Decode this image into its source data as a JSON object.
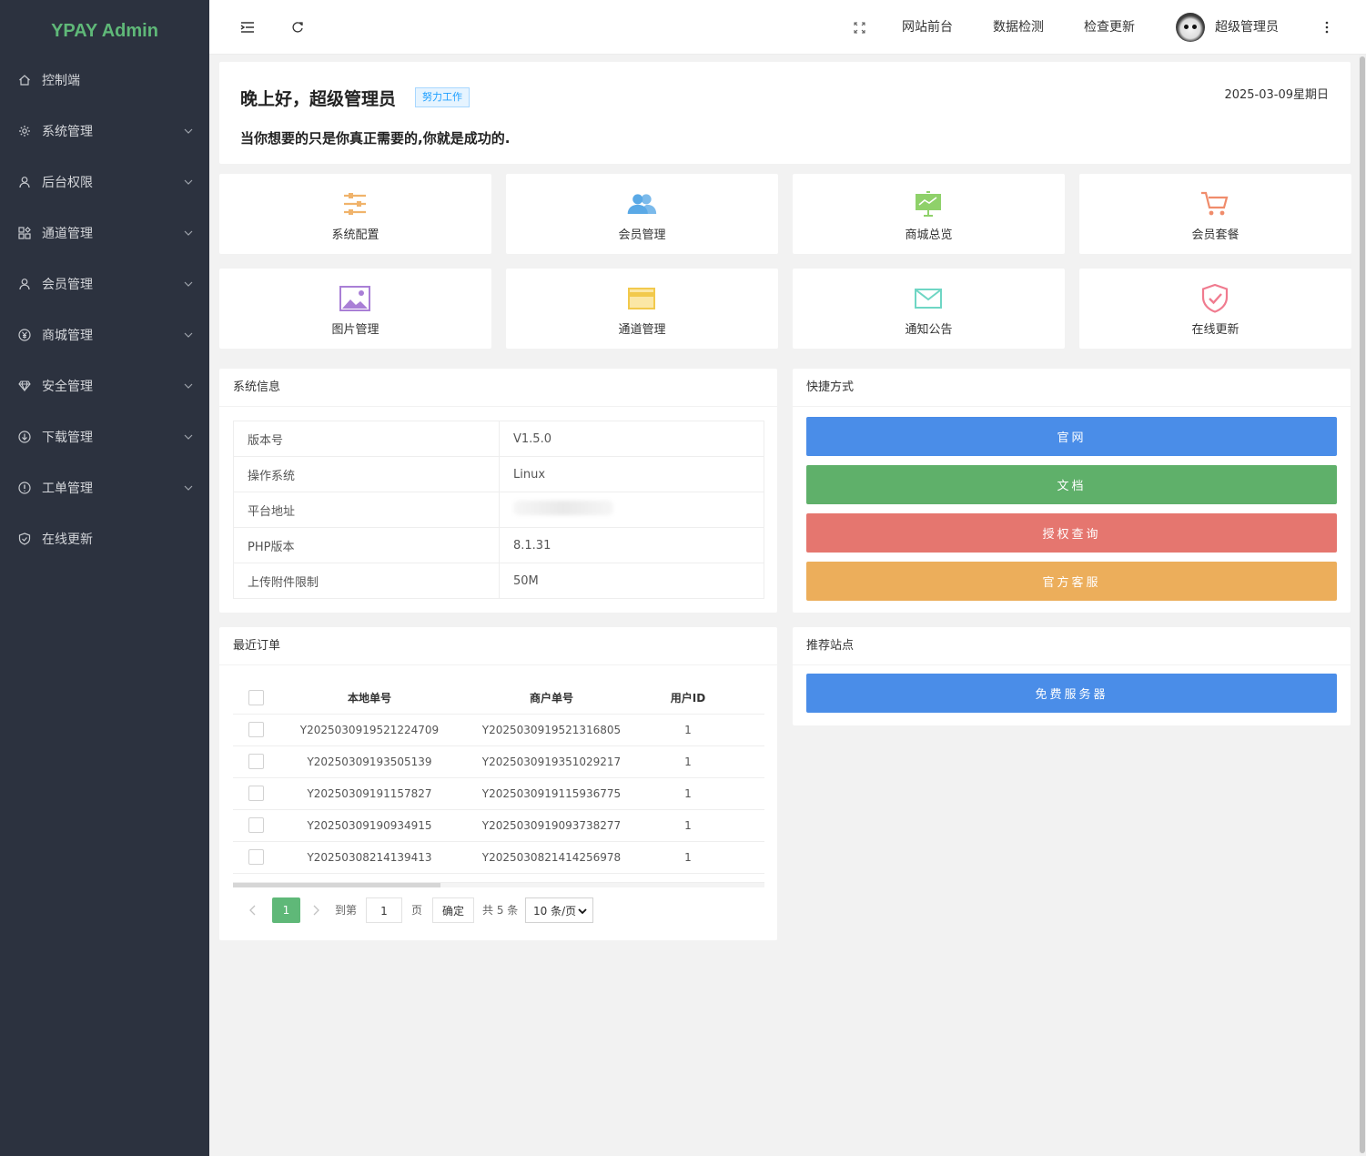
{
  "app": {
    "logo": "YPAY Admin"
  },
  "sidebar": {
    "items": [
      {
        "label": "控制端",
        "icon": "home-icon",
        "expandable": false
      },
      {
        "label": "系统管理",
        "icon": "gear-icon",
        "expandable": true
      },
      {
        "label": "后台权限",
        "icon": "user-icon",
        "expandable": true
      },
      {
        "label": "通道管理",
        "icon": "apps-icon",
        "expandable": true
      },
      {
        "label": "会员管理",
        "icon": "user-icon",
        "expandable": true
      },
      {
        "label": "商城管理",
        "icon": "yen-icon",
        "expandable": true
      },
      {
        "label": "安全管理",
        "icon": "diamond-icon",
        "expandable": true
      },
      {
        "label": "下载管理",
        "icon": "download-icon",
        "expandable": true
      },
      {
        "label": "工单管理",
        "icon": "info-icon",
        "expandable": true
      },
      {
        "label": "在线更新",
        "icon": "shield-check-icon",
        "expandable": false
      }
    ]
  },
  "header": {
    "links": [
      "网站前台",
      "数据检测",
      "检查更新"
    ],
    "username": "超级管理员"
  },
  "welcome": {
    "greeting": "晚上好，超级管理员",
    "badge": "努力工作",
    "date": "2025-03-09星期日",
    "motto": "当你想要的只是你真正需要的,你就是成功的."
  },
  "tiles": [
    {
      "label": "系统配置",
      "icon": "sliders-icon",
      "color": "#f0b36b"
    },
    {
      "label": "会员管理",
      "icon": "users-icon",
      "color": "#5aa9e6"
    },
    {
      "label": "商城总览",
      "icon": "presentation-chart-icon",
      "color": "#8fd16a"
    },
    {
      "label": "会员套餐",
      "icon": "cart-icon",
      "color": "#f08c6b"
    },
    {
      "label": "图片管理",
      "icon": "image-icon",
      "color": "#a97fd6"
    },
    {
      "label": "通道管理",
      "icon": "card-icon",
      "color": "#f2c94c"
    },
    {
      "label": "通知公告",
      "icon": "mail-icon",
      "color": "#6fd6c4"
    },
    {
      "label": "在线更新",
      "icon": "shield-check-icon",
      "color": "#f07b8f"
    }
  ],
  "sysinfo": {
    "title": "系统信息",
    "rows": [
      {
        "key": "版本号",
        "value": "V1.5.0"
      },
      {
        "key": "操作系统",
        "value": "Linux"
      },
      {
        "key": "平台地址",
        "value": ""
      },
      {
        "key": "PHP版本",
        "value": "8.1.31"
      },
      {
        "key": "上传附件限制",
        "value": "50M"
      }
    ]
  },
  "shortcuts": {
    "title": "快捷方式",
    "buttons": [
      {
        "label": "官网",
        "color": "#4a8de8"
      },
      {
        "label": "文档",
        "color": "#5fb06a"
      },
      {
        "label": "授权查询",
        "color": "#e5766f"
      },
      {
        "label": "官方客服",
        "color": "#ecae5b"
      }
    ]
  },
  "orders": {
    "title": "最近订单",
    "columns": [
      "本地单号",
      "商户单号",
      "用户ID"
    ],
    "rows": [
      [
        "Y2025030919521224709",
        "Y2025030919521316805",
        "1"
      ],
      [
        "Y20250309193505139",
        "Y2025030919351029217",
        "1"
      ],
      [
        "Y20250309191157827",
        "Y2025030919115936775",
        "1"
      ],
      [
        "Y20250309190934915",
        "Y2025030919093738277",
        "1"
      ],
      [
        "Y20250308214139413",
        "Y2025030821414256978",
        "1"
      ]
    ],
    "pager": {
      "current": "1",
      "goto_label": "到第",
      "goto_value": "1",
      "page_label": "页",
      "confirm": "确定",
      "total": "共 5 条",
      "page_size": "10 条/页"
    }
  },
  "recommend": {
    "title": "推荐站点",
    "button": {
      "label": "免费服务器",
      "color": "#4a8de8"
    }
  }
}
